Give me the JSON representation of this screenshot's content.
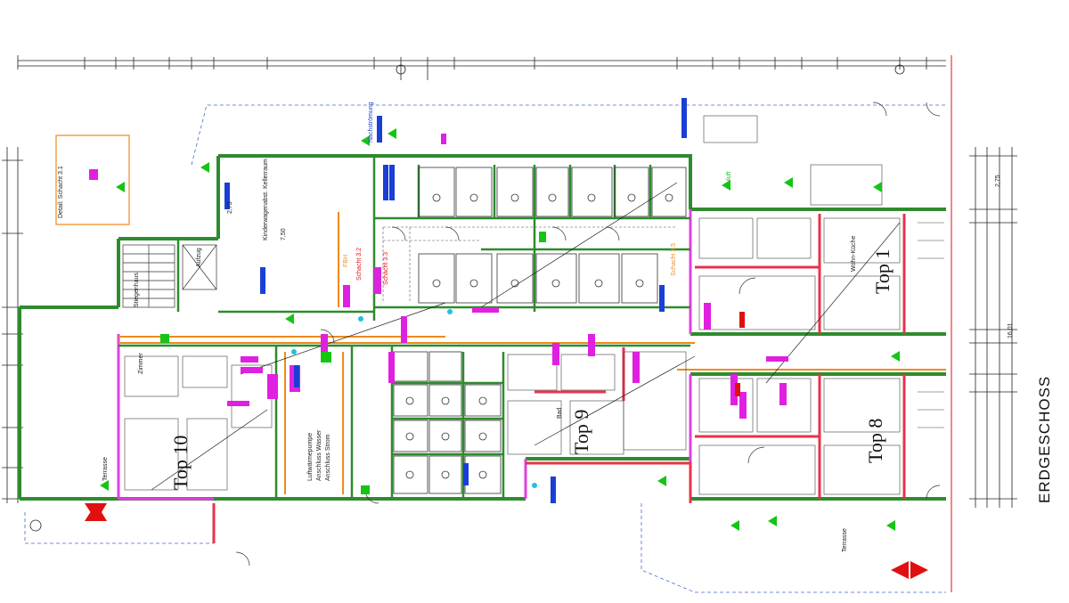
{
  "sheet": {
    "title": "ERDGESCHOSS"
  },
  "units": {
    "top10": "Top 10",
    "top9": "Top 9",
    "top8": "Top 8",
    "top1": "Top 1"
  },
  "labels": {
    "kinderwagen": "Kinderwagenabst. Kellerraum",
    "anschluss_strom": "Anschluss Strom",
    "anschluss_wasser": "Anschluss Wasser",
    "luftwaermepumpe": "Luftwärmepumpe",
    "fbh": "FBH",
    "schacht_32": "Schacht 3.2",
    "schacht_33": "Schacht 3.3",
    "schacht_35": "Schacht 3.5",
    "zuluft": "Zuluft",
    "nachstroemung": "Nachströmung",
    "terrasse": "Terrasse",
    "zimmer": "Zimmer",
    "wohnkueche": "Wohn-Küche",
    "bad": "Bad",
    "dim_a": "2,73",
    "dim_b": "7,50",
    "dim_c": "16,01",
    "dim_d": "2,75",
    "detail": "Detail: Schacht 3.1",
    "stiegenhaus": "Stiegenhaus",
    "aufzug": "Aufzug"
  },
  "colors": {
    "wall_green": "#2e8b2e",
    "wall_red": "#e8334a",
    "wall_magenta": "#e040e0",
    "orange": "#f08a1a",
    "blue": "#1a3fd6",
    "marker_red": "#e01010",
    "arrow_green": "#16c416",
    "cyan": "#20c0e0",
    "text_magenta": "#e020e0"
  }
}
